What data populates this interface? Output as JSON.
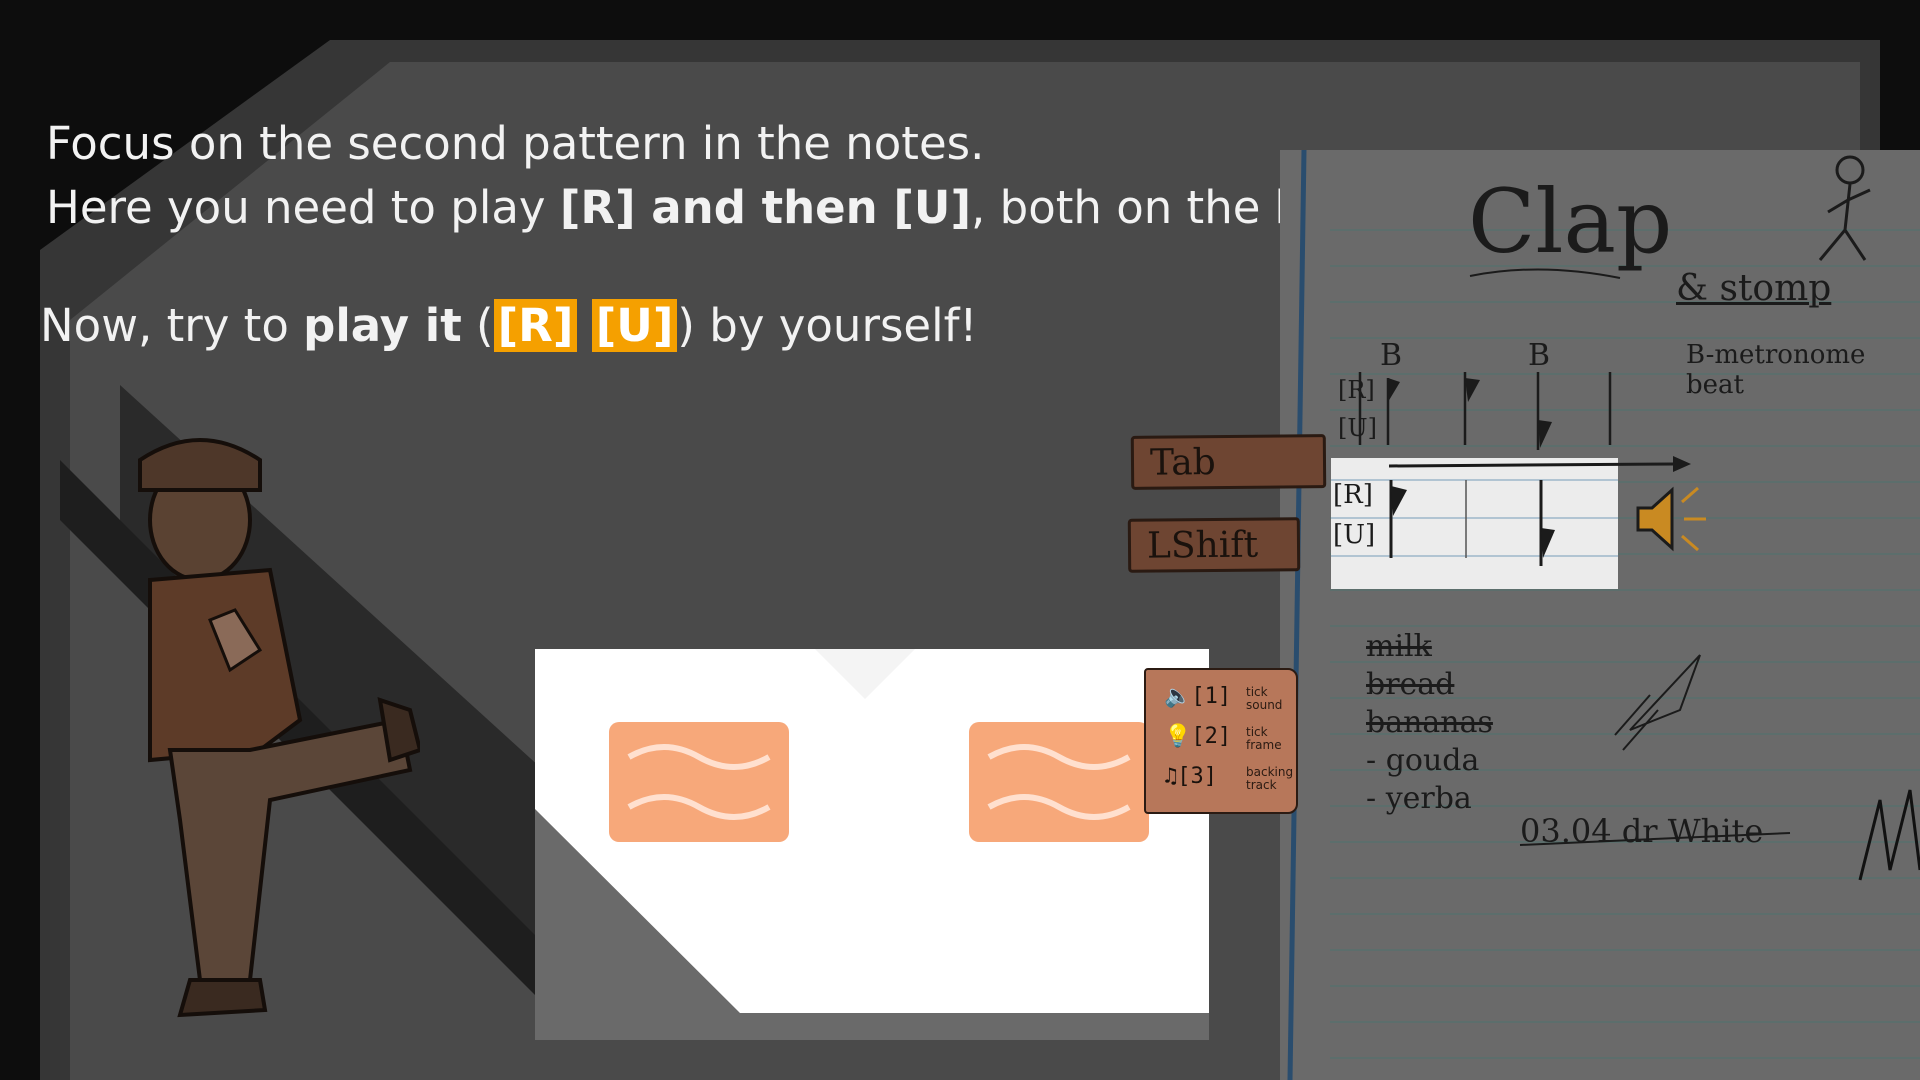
{
  "tutorial": {
    "line1": "Focus on the second pattern in the notes.",
    "line2_pre": "Here you need to play ",
    "line2_bold1": "[R] and then [U]",
    "line2_mid": ", both on the ",
    "line2_bold2": "beat",
    "line2_end": ".",
    "line3_pre": "Now, try to ",
    "line3_bold": "play it",
    "line3_open": " (",
    "key1": "[R]",
    "key2": "[U]",
    "line3_post": ") by yourself!"
  },
  "controls": {
    "tab_label": "Tab",
    "lshift_label": "LShift"
  },
  "options": {
    "rows": [
      {
        "key": "[1]",
        "label_a": "tick",
        "label_b": "sound",
        "icon": "speaker-icon"
      },
      {
        "key": "[2]",
        "label_a": "tick",
        "label_b": "frame",
        "icon": "lightbulb-icon"
      },
      {
        "key": "[3]",
        "label_a": "backing",
        "label_b": "track",
        "icon": "music-notes-icon"
      }
    ]
  },
  "notebook": {
    "title": "Clap",
    "subtitle": "& stomp",
    "beat_marker_1": "B",
    "beat_marker_2": "B",
    "legend": "B-metronome beat",
    "row_r": "[R]",
    "row_u": "[U]",
    "shopping": [
      "milk",
      "bread",
      "bananas",
      "gouda",
      "yerba"
    ],
    "signature": "03.04 dr White"
  },
  "timeline": {
    "row_r": "[R]",
    "row_u": "[U]"
  },
  "colors": {
    "accent": "#f5a000",
    "tile": "#f7a87a",
    "button": "#6e4532",
    "page": "#4a4a4a"
  }
}
